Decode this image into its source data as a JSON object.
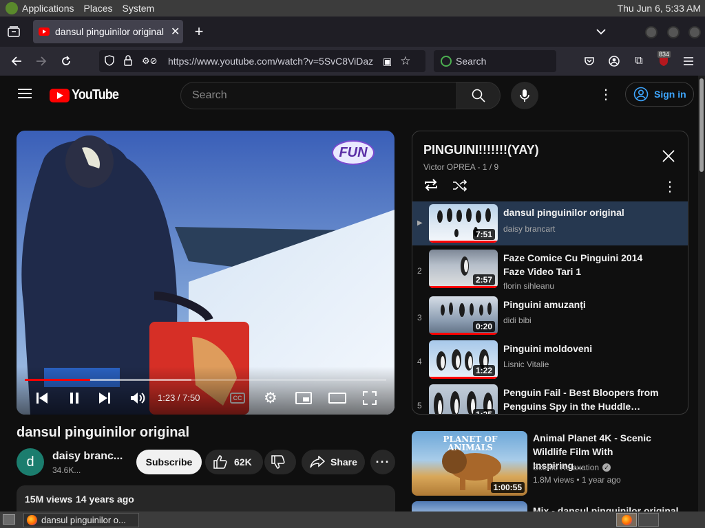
{
  "topbar": {
    "menu": [
      "Applications",
      "Places",
      "System"
    ],
    "clock": "Thu Jun  6, 5:33 AM"
  },
  "browser": {
    "tab_title": "dansul pinguinilor original -",
    "url": "https://www.youtube.com/watch?v=5SvC8ViDaz",
    "search_placeholder": "Search",
    "badge_count": "834"
  },
  "youtube": {
    "logo_text": "YouTube",
    "search_placeholder": "Search",
    "signin_label": "Sign in",
    "player": {
      "channel_logo": "FUN",
      "time": "1:23 / 7:50",
      "progress": 0.18,
      "buffered": 0.46
    },
    "video": {
      "title": "dansul pinguinilor original",
      "channel": "daisy branc...",
      "avatar_letter": "d",
      "subs": "34.6K...",
      "subscribe_label": "Subscribe",
      "likes": "62K",
      "share_label": "Share",
      "views": "15M views",
      "age": "14 years ago"
    },
    "playlist": {
      "title": "PINGUINI!!!!!!!(YAY)",
      "meta": "Victor OPREA - 1 / 9",
      "items": [
        {
          "index": "▶",
          "title": "dansul pinguinilor original",
          "author": "daisy brancart",
          "duration": "7:51"
        },
        {
          "index": "2",
          "title": "Faze Comice Cu Pinguini 2014 Faze Video Tari 1",
          "author": "florin sihleanu",
          "duration": "2:57"
        },
        {
          "index": "3",
          "title": "Pinguini amuzanți",
          "author": "didi bibi",
          "duration": "0:20"
        },
        {
          "index": "4",
          "title": "Pinguini moldoveni",
          "author": "Lisnic Vitalie",
          "duration": "1:22"
        },
        {
          "index": "5",
          "title": "Penguin Fail - Best Bloopers from Penguins Spy in the Huddle…",
          "author": "",
          "duration": "1:25"
        }
      ]
    },
    "recommended": [
      {
        "title": "Animal Planet 4K - Scenic Wildlife Film With Inspiring…",
        "channel": "Scenic Relaxation",
        "views": "1.8M views",
        "age": "1 year ago",
        "duration": "1:00:55",
        "thumb_text": "PLANET OF ANIMALS"
      },
      {
        "title": "Mix - dansul pinguinilor original",
        "channel": "",
        "views": "",
        "age": "",
        "duration": ""
      }
    ]
  },
  "taskbar": {
    "window_title": "dansul pinguinilor o..."
  }
}
